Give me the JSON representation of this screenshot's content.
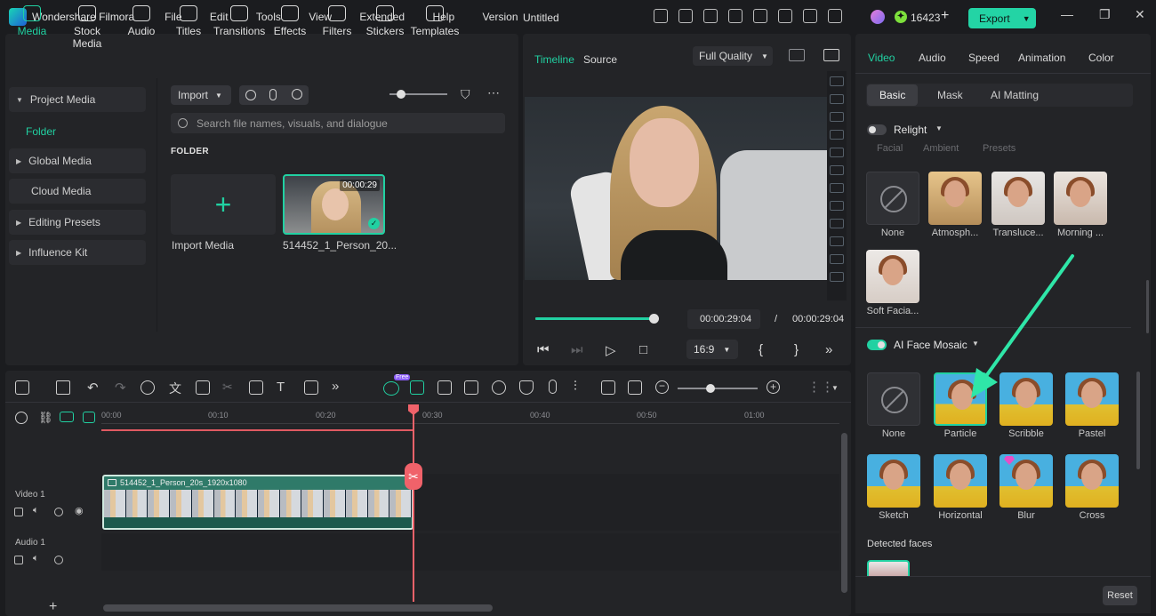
{
  "app": {
    "name": "Wondershare Filmora",
    "document_title": "Untitled",
    "credits": "16423",
    "export_label": "Export",
    "menu": [
      "File",
      "Edit",
      "Tools",
      "View",
      "Extended",
      "Help",
      "Version"
    ]
  },
  "media_tabs": [
    {
      "label": "Media",
      "icon": "media-icon",
      "active": true
    },
    {
      "label": "Stock Media",
      "icon": "stock-media-icon"
    },
    {
      "label": "Audio",
      "icon": "audio-note-icon"
    },
    {
      "label": "Titles",
      "icon": "titles-icon"
    },
    {
      "label": "Transitions",
      "icon": "transitions-icon"
    },
    {
      "label": "Effects",
      "icon": "effects-icon"
    },
    {
      "label": "Filters",
      "icon": "filters-icon"
    },
    {
      "label": "Stickers",
      "icon": "stickers-icon"
    },
    {
      "label": "Templates",
      "icon": "templates-icon"
    }
  ],
  "sidebar": {
    "project_media": "Project Media",
    "folder": "Folder",
    "global_media": "Global Media",
    "cloud_media": "Cloud Media",
    "editing_presets": "Editing Presets",
    "influence_kit": "Influence Kit"
  },
  "media": {
    "import_label": "Import",
    "search_placeholder": "Search file names, visuals, and dialogue",
    "folder_heading": "FOLDER",
    "import_media_caption": "Import Media",
    "clip_caption": "514452_1_Person_20...",
    "clip_duration": "00:00:29"
  },
  "preview": {
    "tab_timeline": "Timeline",
    "tab_source": "Source",
    "quality": "Full Quality",
    "progress": 1.0,
    "current_time": "00:00:29:04",
    "separator": "/",
    "total_time": "00:00:29:04",
    "ratio": "16:9",
    "bracket_in": "{",
    "bracket_out": "}"
  },
  "props": {
    "tabs": [
      "Video",
      "Audio",
      "Speed",
      "Animation",
      "Color"
    ],
    "subtabs": [
      "Basic",
      "Mask",
      "AI Matting"
    ],
    "relight": {
      "label": "Relight",
      "enabled": false,
      "modes": [
        "Facial",
        "Ambient",
        "Presets"
      ],
      "presets": [
        "None",
        "Atmosph...",
        "Transluce...",
        "Morning ...",
        "Soft Facia..."
      ]
    },
    "face_mosaic": {
      "label": "AI Face Mosaic",
      "enabled": true,
      "selected": "Particle",
      "styles": [
        "None",
        "Particle",
        "Scribble",
        "Pastel",
        "Sketch",
        "Horizontal",
        "Blur",
        "Cross"
      ]
    },
    "detected_faces": "Detected faces",
    "reset_label": "Reset"
  },
  "timeline": {
    "free_badge": "Free",
    "ruler": [
      "00:00",
      "00:10",
      "00:20",
      "00:30",
      "00:40",
      "00:50",
      "01:00"
    ],
    "video_track": "Video 1",
    "audio_track": "Audio 1",
    "clip_name": "514452_1_Person_20s_1920x1080",
    "add_track": "+"
  },
  "colors": {
    "accent": "#21d1a2",
    "playhead": "#f0626a",
    "export_button": "#23d4a5"
  }
}
